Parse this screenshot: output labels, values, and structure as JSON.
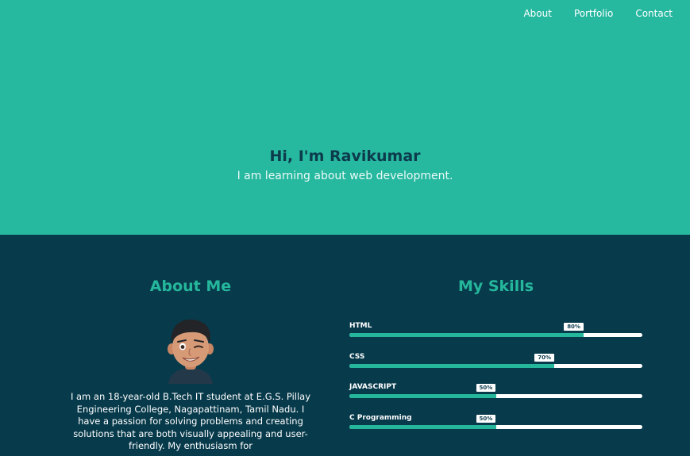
{
  "nav": {
    "items": [
      {
        "label": "About"
      },
      {
        "label": "Portfolio"
      },
      {
        "label": "Contact"
      }
    ]
  },
  "hero": {
    "title": "Hi, I'm Ravikumar",
    "subtitle": "I am learning about web development."
  },
  "about": {
    "heading": "About Me",
    "text": "I am an 18-year-old B.Tech IT student at E.G.S. Pillay Engineering College, Nagapattinam, Tamil Nadu. I have a passion for solving problems and creating solutions that are both visually appealing and user-friendly. My enthusiasm for"
  },
  "skills": {
    "heading": "My Skills",
    "items": [
      {
        "name": "HTML",
        "badge": "80%",
        "level": 0.8
      },
      {
        "name": "CSS",
        "badge": "70%",
        "level": 0.7
      },
      {
        "name": "JAVASCRIPT",
        "badge": "50%",
        "level": 0.5
      },
      {
        "name": "C Programming",
        "badge": "50%",
        "level": 0.5
      }
    ]
  },
  "colors": {
    "hero_bg": "#27b8a0",
    "content_bg": "#073a4b",
    "accent": "#25b79c"
  }
}
